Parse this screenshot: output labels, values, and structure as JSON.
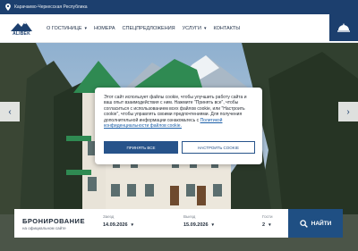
{
  "topbar": {
    "location": "Карачаево-Черкесская Республика",
    "pin_icon": "map-pin-icon"
  },
  "logo": {
    "text": "ALIBEK"
  },
  "nav": {
    "items": [
      {
        "label": "О гостинице",
        "dropdown": true
      },
      {
        "label": "Номера",
        "dropdown": false
      },
      {
        "label": "Спецпредложения",
        "dropdown": false
      },
      {
        "label": "Услуги",
        "dropdown": true
      },
      {
        "label": "Контакты",
        "dropdown": false
      }
    ]
  },
  "reception_icon": "service-bell-icon",
  "carousel": {
    "prev": "‹",
    "next": "›"
  },
  "cookie": {
    "text": "Этот сайт использует файлы cookie, чтобы улучшить работу сайта и ваш опыт взаимодействия с ним. Нажмите \"Принять все\", чтобы согласиться с использованием всех файлов cookie, или \"Настроить cookie\", чтобы управлять своими предпочтениями. Для получения дополнительной информации ознакомьтесь с",
    "link": "Политикой конфиденциальности файлов cookie.",
    "accept_label": "Принять все",
    "setup_label": "Настроить cookie"
  },
  "booking": {
    "title": "Бронирование",
    "subtitle": "на официальном сайте",
    "checkin_label": "Заезд",
    "checkin_value": "14.09.2026",
    "checkout_label": "Выезд",
    "checkout_value": "15.09.2026",
    "guests_label": "Гости",
    "guests_value": "2",
    "find_label": "Найти"
  },
  "colors": {
    "brand": "#1c3f6e",
    "accent": "#27538a",
    "roof": "#2f8a52"
  }
}
